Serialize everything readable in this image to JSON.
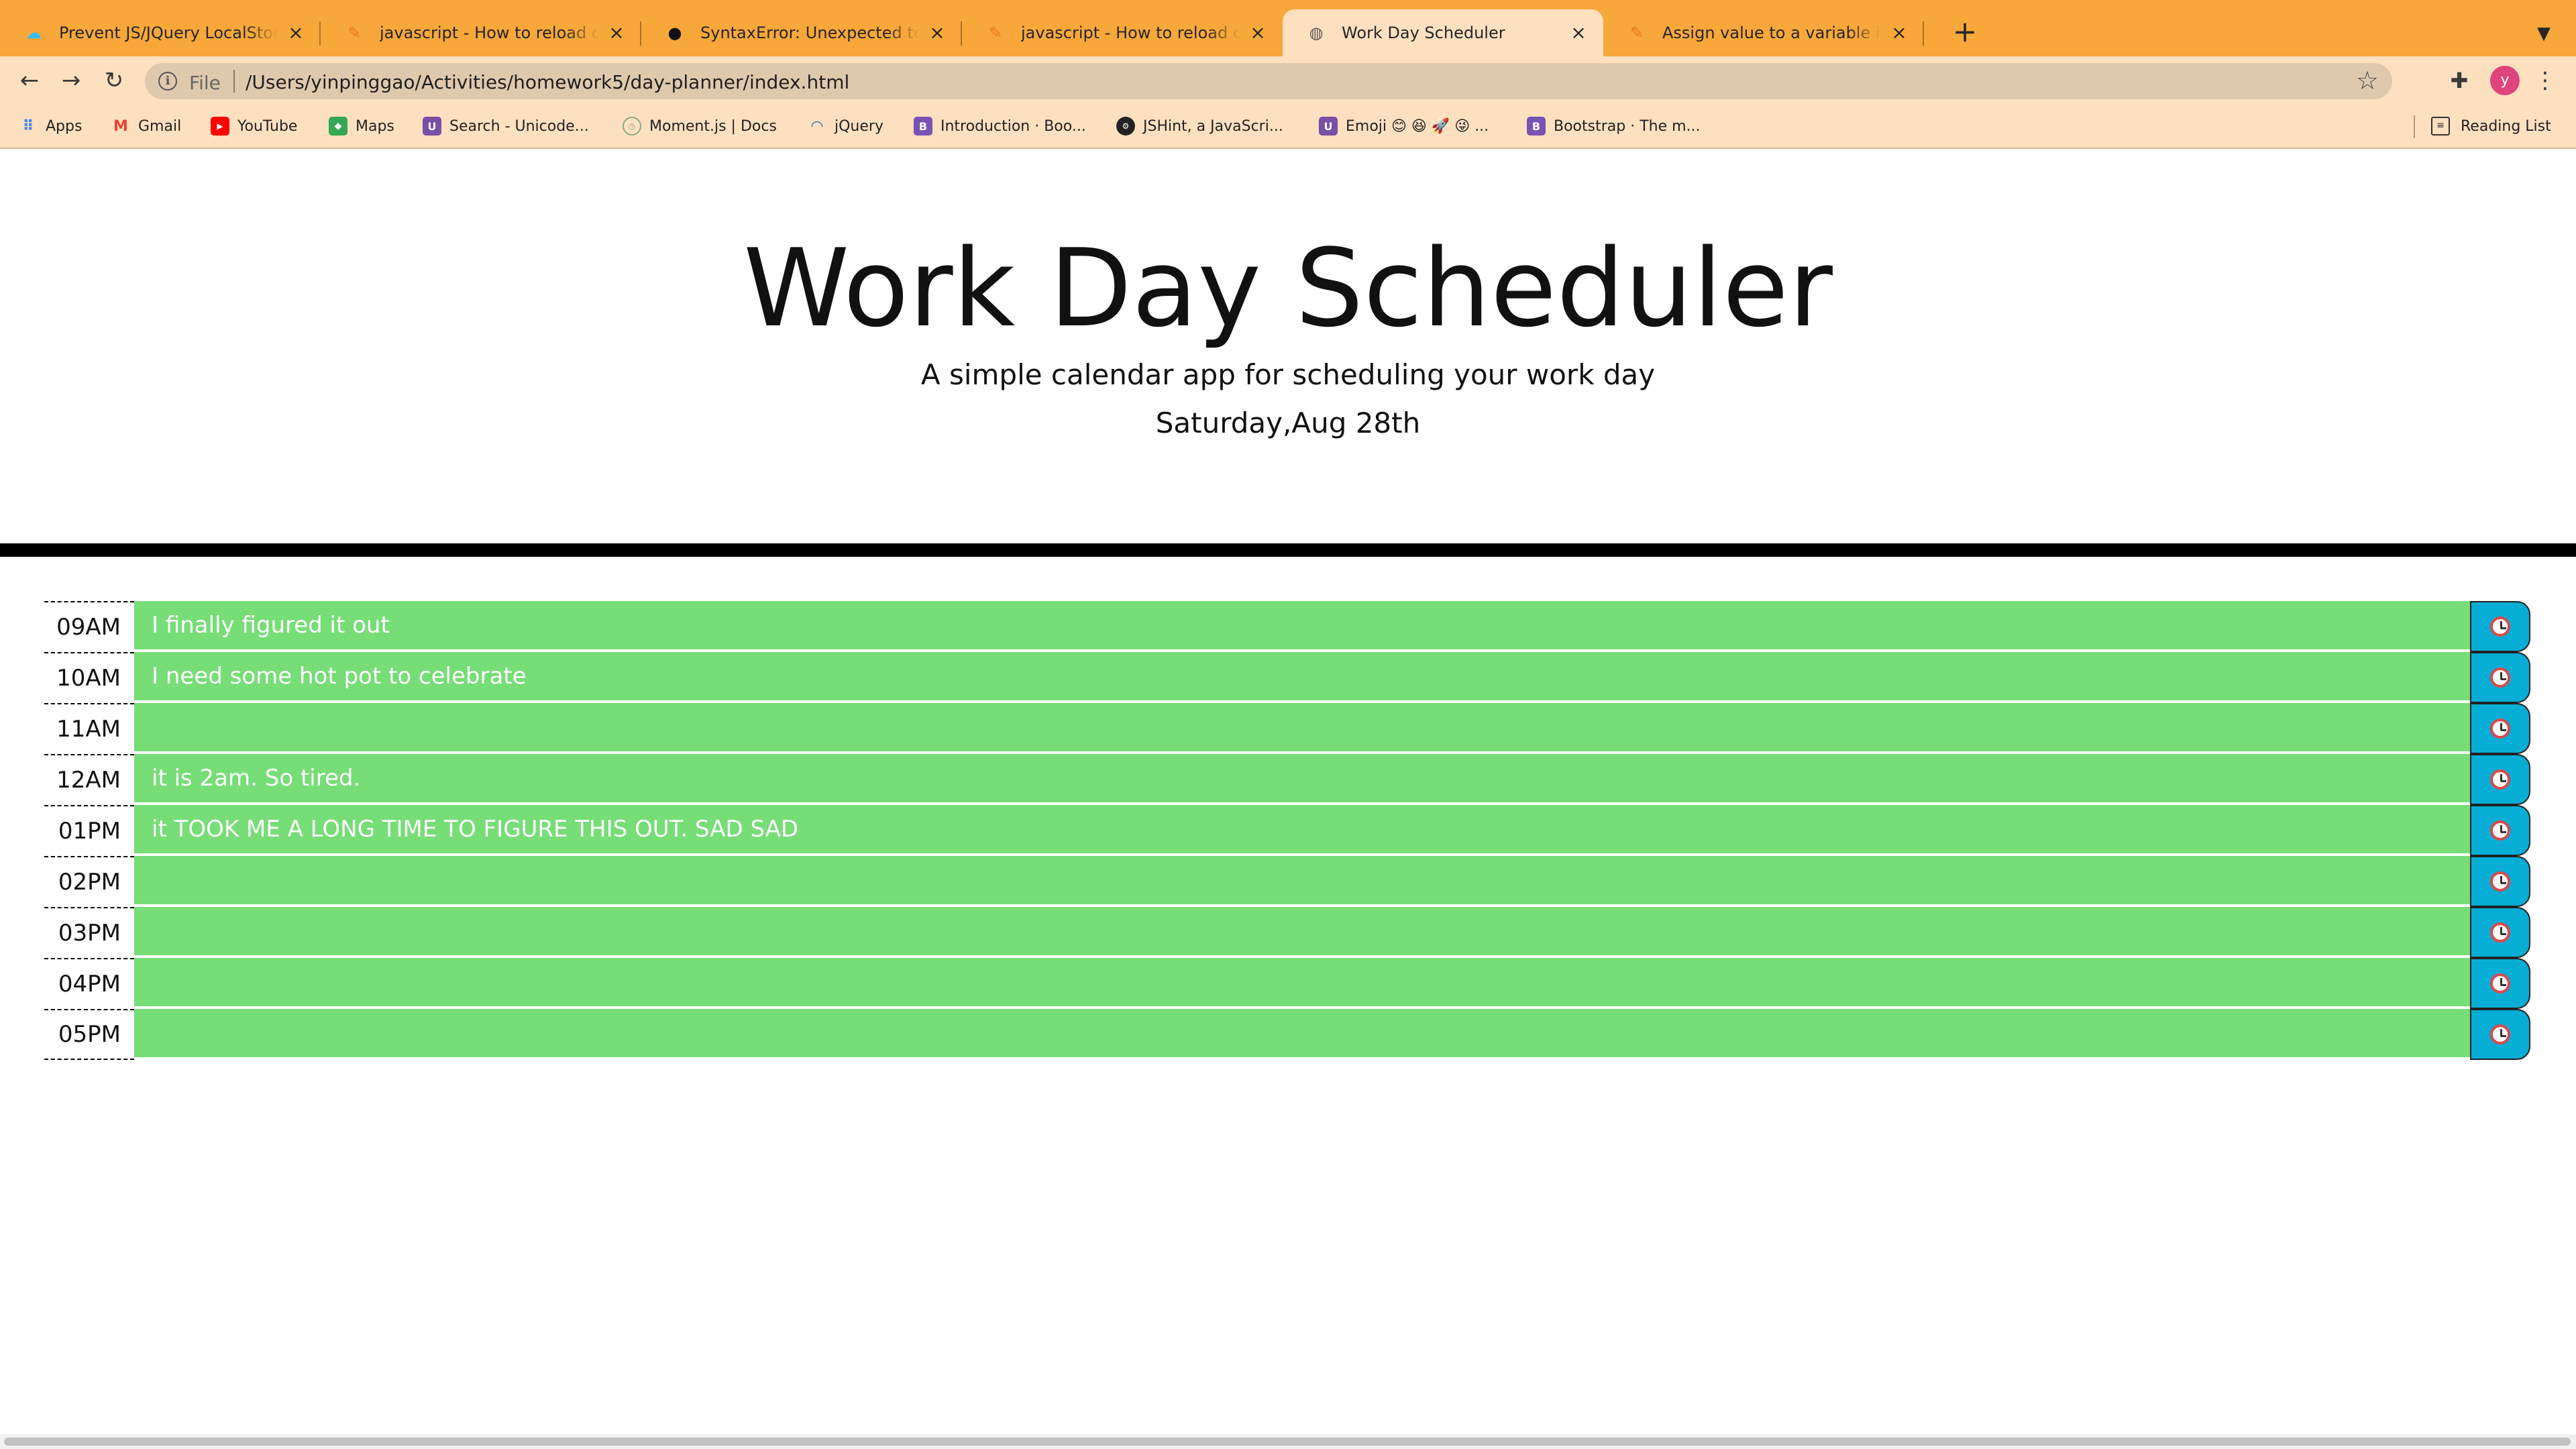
{
  "browser": {
    "tabs": [
      {
        "title": "Prevent JS/JQuery LocalStorage",
        "favicon": "tailwind-icon",
        "active": false
      },
      {
        "title": "javascript - How to reload current",
        "favicon": "stackoverflow-icon",
        "active": false
      },
      {
        "title": "SyntaxError: Unexpected token",
        "favicon": "github-icon",
        "active": false
      },
      {
        "title": "javascript - How to reload current",
        "favicon": "stackoverflow-icon",
        "active": false
      },
      {
        "title": "Work Day Scheduler",
        "favicon": "globe-icon",
        "active": true
      },
      {
        "title": "Assign value to a variable in jquery",
        "favicon": "stackoverflow-icon",
        "active": false
      }
    ],
    "omnibox": {
      "scheme_label": "File",
      "url": "/Users/yinpinggao/Activities/homework5/day-planner/index.html"
    },
    "avatar_letter": "y",
    "bookmarks": [
      {
        "label": "Apps",
        "icon": "apps-grid-icon",
        "color": "#4285f4"
      },
      {
        "label": "Gmail",
        "icon": "gmail-icon",
        "color": "#ea4335"
      },
      {
        "label": "YouTube",
        "icon": "youtube-icon",
        "color": "#ff0000"
      },
      {
        "label": "Maps",
        "icon": "maps-icon",
        "color": "#34a853"
      },
      {
        "label": "Search - Unicode...",
        "icon": "unicode-icon",
        "color": "#7b4fa6"
      },
      {
        "label": "Moment.js | Docs",
        "icon": "moment-icon",
        "color": "#8aaa88"
      },
      {
        "label": "jQuery",
        "icon": "jquery-icon",
        "color": "#2d6ea8"
      },
      {
        "label": "Introduction · Boo...",
        "icon": "bootstrap-icon",
        "color": "#7952b3"
      },
      {
        "label": "JSHint, a JavaScri...",
        "icon": "jshint-icon",
        "color": "#222222"
      },
      {
        "label": "Emoji 😊 😆 🚀 😜 ...",
        "icon": "unicode-icon",
        "color": "#7b4fa6"
      },
      {
        "label": "Bootstrap · The m...",
        "icon": "bootstrap-icon",
        "color": "#7952b3"
      }
    ],
    "reading_list_label": "Reading List",
    "colors": {
      "tabstrip": "#f8a73a",
      "toolbar": "#fde0c0"
    }
  },
  "app": {
    "title": "Work Day Scheduler",
    "lead": "A simple calendar app for scheduling your work day",
    "current_day": "Saturday,Aug 28th",
    "rows": [
      {
        "hour": "09AM",
        "text": "I finally figured it out"
      },
      {
        "hour": "10AM",
        "text": "I need some hot pot to celebrate"
      },
      {
        "hour": "11AM",
        "text": ""
      },
      {
        "hour": "12AM",
        "text": "it is 2am. So tired."
      },
      {
        "hour": "01PM",
        "text": "it TOOK ME A LONG TIME TO FIGURE THIS OUT. SAD SAD"
      },
      {
        "hour": "02PM",
        "text": ""
      },
      {
        "hour": "03PM",
        "text": ""
      },
      {
        "hour": "04PM",
        "text": ""
      },
      {
        "hour": "05PM",
        "text": ""
      }
    ],
    "colors": {
      "future": "#77dd77",
      "save": "#06aed5"
    },
    "save_icon": "alarm-clock-icon"
  }
}
